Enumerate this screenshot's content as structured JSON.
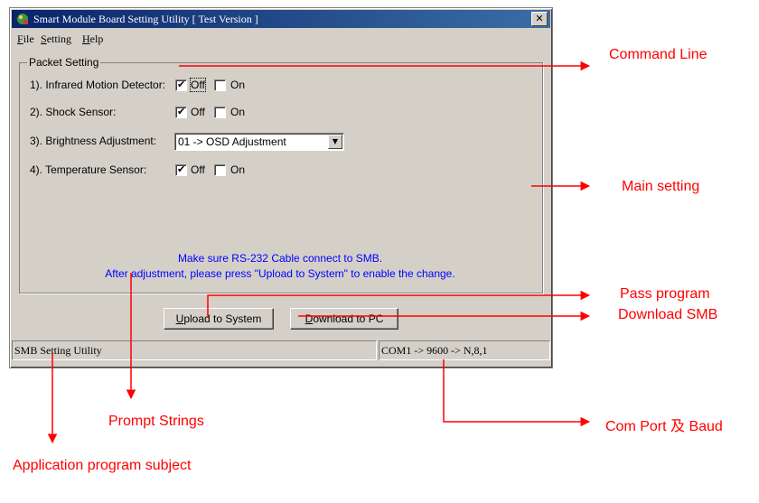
{
  "window": {
    "title": "Smart Module Board Setting Utility [ Test Version ]",
    "close_glyph": "✕"
  },
  "menu": [
    "File",
    "Setting",
    "Help"
  ],
  "group": {
    "title": "Packet Setting",
    "rows": [
      {
        "label": "1). Infrared Motion Detector:",
        "off_checked": true,
        "on_checked": false,
        "off": "Off",
        "on": "On"
      },
      {
        "label": "2). Shock Sensor:",
        "off_checked": true,
        "on_checked": false,
        "off": "Off",
        "on": "On"
      },
      {
        "label": "3). Brightness Adjustment:",
        "select_value": "01 -> OSD Adjustment"
      },
      {
        "label": "4). Temperature Sensor:",
        "off_checked": true,
        "on_checked": false,
        "off": "Off",
        "on": "On"
      }
    ],
    "note_line1": "Make sure RS-232 Cable connect to SMB.",
    "note_line2": "After adjustment, please press \"Upload to System\" to enable the change."
  },
  "buttons": {
    "upload": "Upload to System",
    "download": "Download to PC"
  },
  "status": {
    "left": "SMB Setting Utility",
    "right": "COM1 -> 9600 -> N,8,1"
  },
  "annotations": {
    "command_line": "Command Line",
    "main_setting": "Main setting",
    "pass_program": "Pass program",
    "download_smb": "Download SMB",
    "prompt_strings": "Prompt Strings",
    "com_port": "Com Port 及 Baud",
    "app_subject": "Application program subject"
  },
  "icons": {
    "check_glyph": "✔",
    "dropdown_glyph": "▼"
  },
  "colors": {
    "annotation": "#ff0000",
    "titlebar": "#0a246a",
    "note_text": "#0000ff",
    "dialog_bg": "#d4d0c8"
  }
}
